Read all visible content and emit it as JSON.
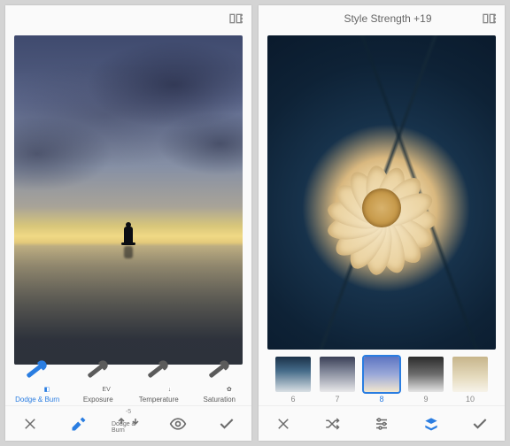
{
  "left": {
    "title": "",
    "tools": [
      {
        "label": "Dodge & Burn",
        "badge": "◧",
        "selected": true
      },
      {
        "label": "Exposure",
        "badge": "EV"
      },
      {
        "label": "Temperature",
        "badge": "↓"
      },
      {
        "label": "Saturation",
        "badge": "✿"
      }
    ],
    "bottom": {
      "value_top": "-5",
      "value_bottom": "Dodge & Burn"
    }
  },
  "right": {
    "title": "Style Strength +19",
    "filters": [
      {
        "label": "6"
      },
      {
        "label": "7"
      },
      {
        "label": "8",
        "selected": true
      },
      {
        "label": "9"
      },
      {
        "label": "10"
      }
    ]
  }
}
